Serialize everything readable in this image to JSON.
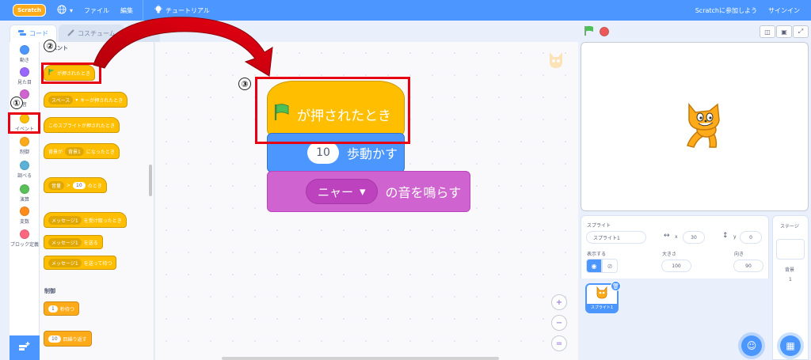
{
  "menubar": {
    "logo": "Scratch",
    "language_icon": "globe-icon",
    "file": "ファイル",
    "edit": "編集",
    "tutorials": "チュートリアル",
    "join": "Scratchに参加しよう",
    "signin": "サインイン"
  },
  "tabs": {
    "code": "コード",
    "costume": "コスチューム",
    "sound": "音"
  },
  "categories": [
    {
      "label": "動き",
      "color": "#4c97ff"
    },
    {
      "label": "見た目",
      "color": "#9966ff"
    },
    {
      "label": "音",
      "color": "#cf63cf"
    },
    {
      "label": "イベント",
      "color": "#ffbf00"
    },
    {
      "label": "制御",
      "color": "#ffab19"
    },
    {
      "label": "調べる",
      "color": "#5cb1d6"
    },
    {
      "label": "演算",
      "color": "#59c059"
    },
    {
      "label": "変数",
      "color": "#ff8c1a"
    },
    {
      "label": "ブロック定義",
      "color": "#ff6680"
    }
  ],
  "palette": {
    "events_heading": "イベント",
    "when_flag": "が押されたとき",
    "when_key_dd": "スペース",
    "when_key": "キーが押されたとき",
    "when_sprite_clicked": "このスプライトが押されたとき",
    "when_backdrop_pre": "背景が",
    "when_backdrop_dd": "背景1",
    "when_backdrop_post": "になったとき",
    "when_gt_dd": "音量",
    "when_gt_op": ">",
    "when_gt_val": "10",
    "when_gt_post": "のとき",
    "when_receive_dd": "メッセージ1",
    "when_receive": "を受け取ったとき",
    "broadcast_dd": "メッセージ1",
    "broadcast": "を送る",
    "broadcast_wait_dd": "メッセージ1",
    "broadcast_wait": "を送って待つ",
    "control_heading": "制御",
    "wait_val": "1",
    "wait": "秒待つ",
    "repeat_val": "10",
    "repeat": "回繰り返す"
  },
  "script": {
    "hat_label": "が押されたとき",
    "move_value": "10",
    "move_label": "歩動かす",
    "sound_dd": "ニャー",
    "sound_label": "の音を鳴らす"
  },
  "markers": {
    "one": "①",
    "two": "②",
    "three": "③"
  },
  "zoom": {
    "in": "+",
    "out": "−",
    "reset": "="
  },
  "sprite_info": {
    "sprite_label": "スプライト",
    "sprite_name": "スプライト1",
    "x_label": "x",
    "x_value": "30",
    "y_label": "y",
    "y_value": "0",
    "show_label": "表示する",
    "size_label": "大きさ",
    "size_value": "100",
    "direction_label": "向き",
    "direction_value": "90",
    "thumb_name": "スプライト1"
  },
  "stage_panel": {
    "label": "ステージ",
    "backdrops_label": "背景",
    "backdrops_count": "1"
  },
  "colors": {
    "accent": "#4c97ff",
    "annotation": "#e60012"
  }
}
